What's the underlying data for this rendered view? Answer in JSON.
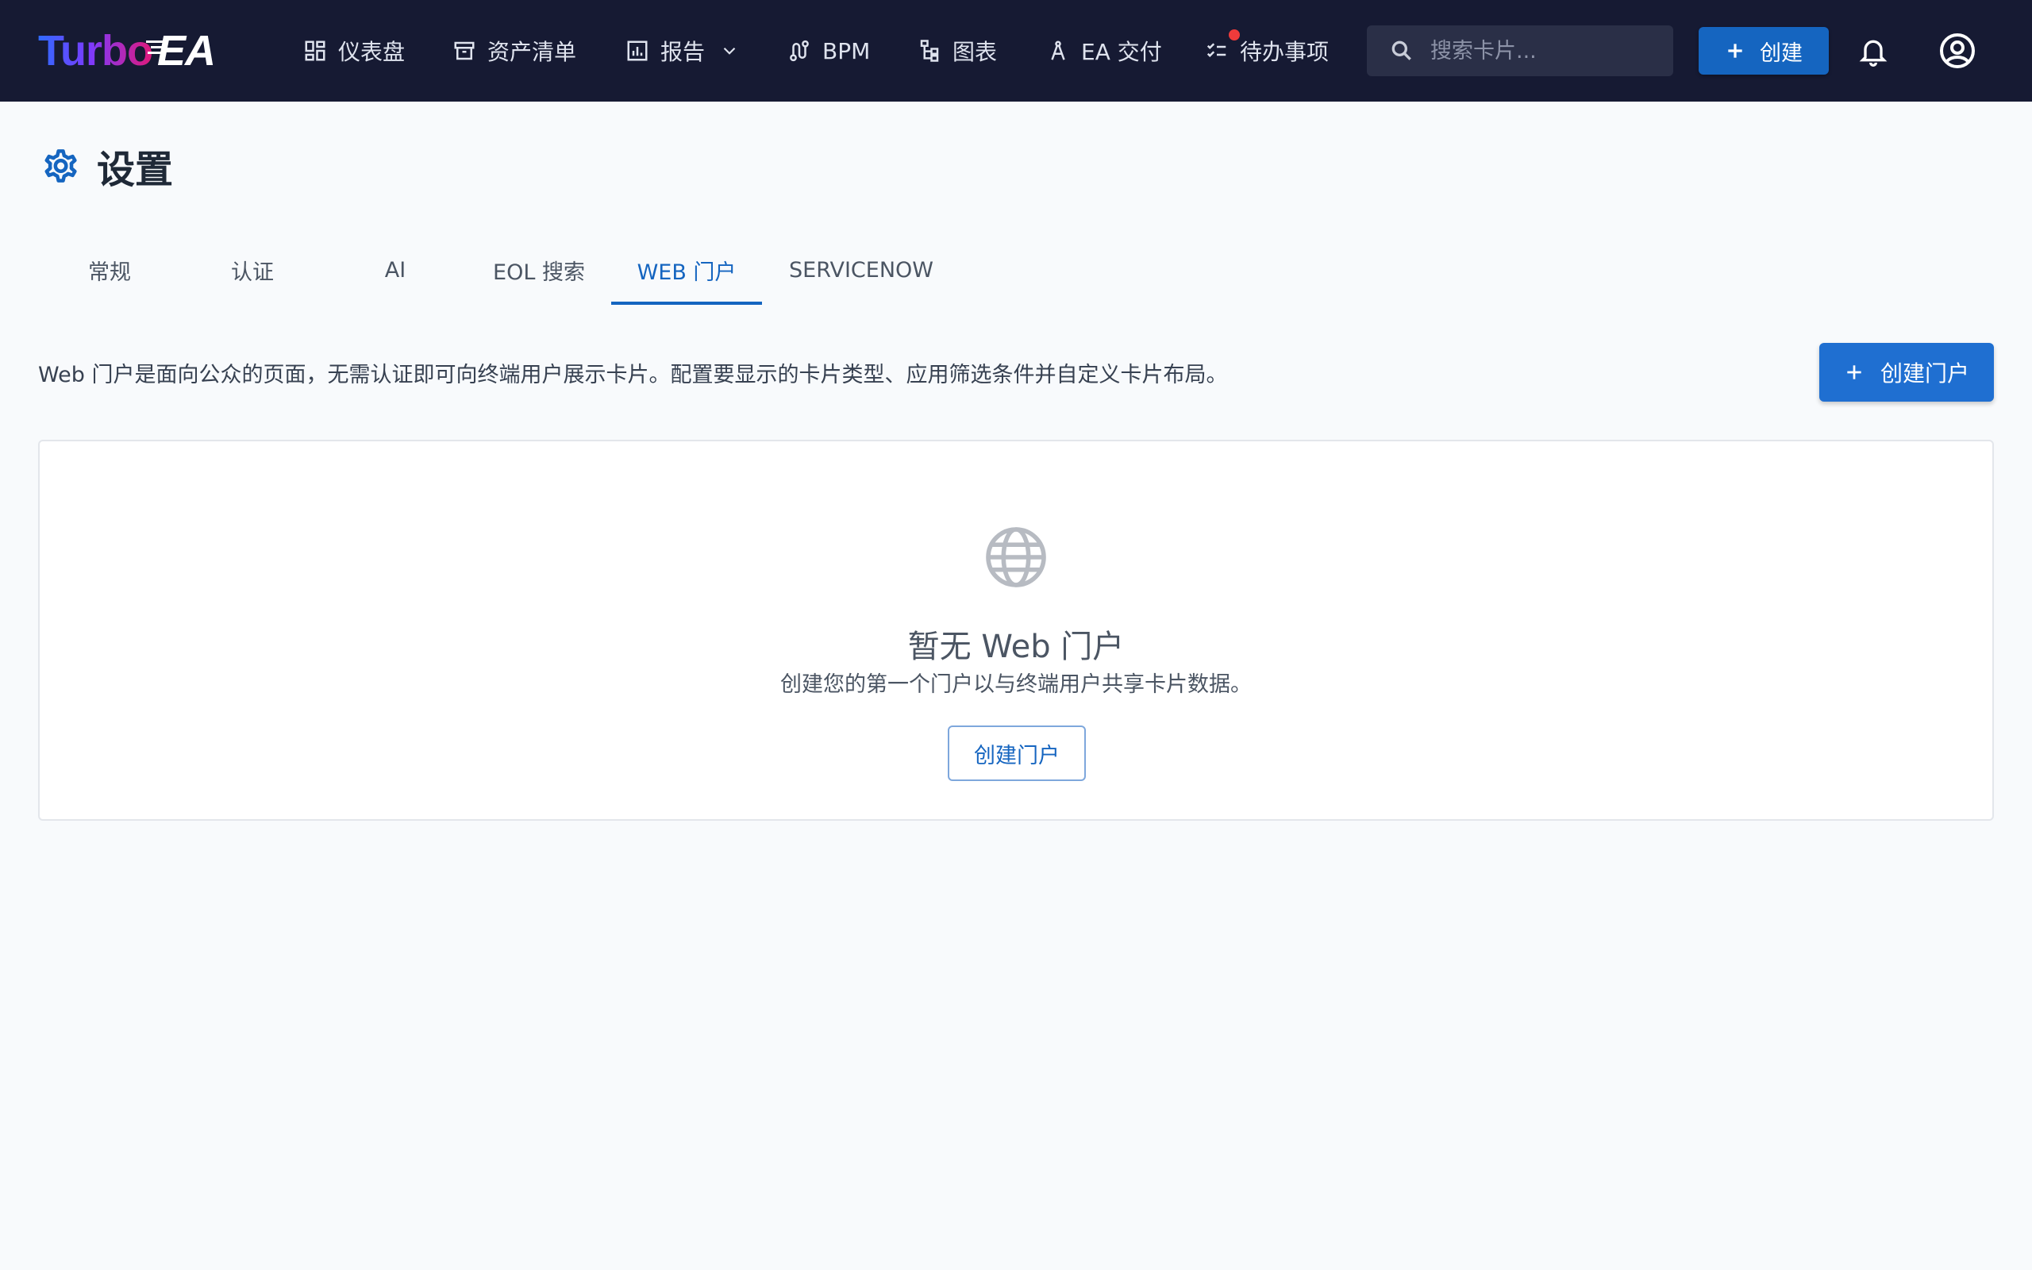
{
  "app": {
    "logo_part1": "Turbo",
    "logo_part2": "EA"
  },
  "nav": {
    "items": [
      {
        "label": "仪表盘",
        "icon": "dashboard-icon"
      },
      {
        "label": "资产清单",
        "icon": "archive-icon"
      },
      {
        "label": "报告",
        "icon": "report-chart-icon"
      },
      {
        "label": "BPM",
        "icon": "route-icon"
      },
      {
        "label": "图表",
        "icon": "diagram-icon"
      },
      {
        "label": "EA 交付",
        "icon": "compass-icon"
      },
      {
        "label": "待办事项",
        "icon": "checklist-icon"
      }
    ],
    "search_placeholder": "搜索卡片...",
    "create_label": "创建"
  },
  "page": {
    "title": "设置",
    "tabs": [
      "常规",
      "认证",
      "AI",
      "EOL 搜索",
      "WEB 门户",
      "SERVICENOW"
    ],
    "active_tab": "WEB 门户",
    "intro": "Web 门户是面向公众的页面，无需认证即可向终端用户展示卡片。配置要显示的卡片类型、应用筛选条件并自定义卡片布局。",
    "create_portal_label": "创建门户"
  },
  "empty_state": {
    "title": "暂无 Web 门户",
    "subtitle": "创建您的第一个门户以与终端用户共享卡片数据。",
    "button_label": "创建门户"
  },
  "colors": {
    "topbar": "#161a33",
    "accent": "#1565c0",
    "notification_dot": "#ef3b3b"
  }
}
